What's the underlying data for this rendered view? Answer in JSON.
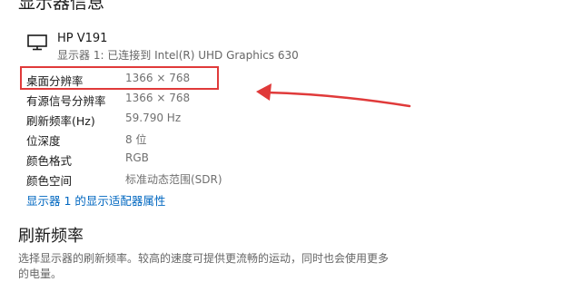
{
  "header": {
    "title": "显示器信息"
  },
  "monitor": {
    "name": "HP V191",
    "subtitle": "显示器 1: 已连接到 Intel(R) UHD Graphics 630",
    "icon": "monitor-icon"
  },
  "properties": [
    {
      "label": "桌面分辨率",
      "value": "1366 × 768"
    },
    {
      "label": "有源信号分辨率",
      "value": "1366 × 768"
    },
    {
      "label": "刷新频率(Hz)",
      "value": "59.790 Hz"
    },
    {
      "label": "位深度",
      "value": "8 位"
    },
    {
      "label": "颜色格式",
      "value": "RGB"
    },
    {
      "label": "颜色空间",
      "value": "标准动态范围(SDR)"
    }
  ],
  "adapter_link": "显示器 1 的显示适配器属性",
  "refresh_section": {
    "title": "刷新频率",
    "description": "选择显示器的刷新频率。较高的速度可提供更流畅的运动，同时也会使用更多的电量。"
  },
  "annotation": {
    "color": "#e03a3a"
  }
}
